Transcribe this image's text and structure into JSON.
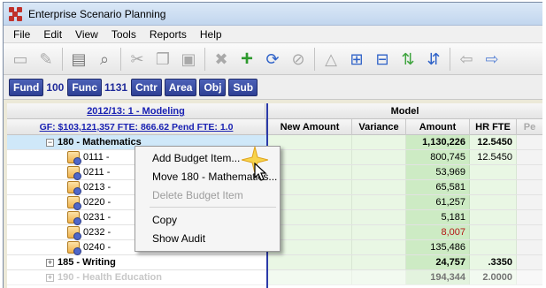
{
  "window": {
    "title": "Enterprise Scenario Planning",
    "accent_color": "#2b3aa8"
  },
  "menu": [
    "File",
    "Edit",
    "View",
    "Tools",
    "Reports",
    "Help"
  ],
  "toolbar": {
    "icons": [
      "save-icon",
      "edit-document-icon",
      "print-icon",
      "print-preview-icon",
      "cut-icon",
      "copy-icon",
      "paste-icon",
      "delete-icon",
      "add-icon",
      "refresh-icon",
      "cancel-icon",
      "budget-icon",
      "expand-icon",
      "collapse-icon",
      "sort-up-icon",
      "sort-down-icon",
      "back-icon",
      "forward-icon"
    ]
  },
  "filters": {
    "fund_label": "Fund",
    "fund_value": "100",
    "func_label": "Func",
    "func_value": "1131",
    "cntr_label": "Cntr",
    "area_label": "Area",
    "obj_label": "Obj",
    "sub_label": "Sub"
  },
  "grid": {
    "scenario_link": "2012/13: 1 - Modeling",
    "summary_link": "GF: $103,121,357  FTE: 866.62  Pend FTE: 1.0",
    "model_header": "Model",
    "columns": {
      "new_amount": "New Amount",
      "variance": "Variance",
      "amount": "Amount",
      "hr_fte": "HR FTE",
      "pe": "Pe"
    },
    "rows": [
      {
        "label": "180 - Mathematics",
        "amount": "1,130,226",
        "fte": "12.5450",
        "type": "group-open"
      },
      {
        "label": "0111 -",
        "amount": "800,745",
        "fte": "12.5450",
        "type": "leaf"
      },
      {
        "label": "0211 -",
        "amount": "53,969",
        "fte": "",
        "type": "leaf"
      },
      {
        "label": "0213 -",
        "amount": "65,581",
        "fte": "",
        "type": "leaf"
      },
      {
        "label": "0220 -",
        "amount": "61,257",
        "fte": "",
        "type": "leaf"
      },
      {
        "label": "0231 -",
        "amount": "5,181",
        "fte": "",
        "type": "leaf"
      },
      {
        "label": "0232 -",
        "amount": "8,007",
        "fte": "",
        "type": "leaf",
        "negative": true
      },
      {
        "label": "0240 -",
        "amount": "135,486",
        "fte": "",
        "type": "leaf"
      },
      {
        "label": "185 - Writing",
        "amount": "24,757",
        "fte": ".3350",
        "type": "group-closed"
      },
      {
        "label": "190 - Health Education",
        "amount": "194,344",
        "fte": "2.0000",
        "type": "group-closed",
        "faded": true
      }
    ]
  },
  "context_menu": {
    "add_budget_item": "Add Budget Item...",
    "move": "Move 180 - Mathematics...",
    "delete_budget_item": "Delete Budget Item",
    "copy": "Copy",
    "show_audit": "Show Audit"
  }
}
